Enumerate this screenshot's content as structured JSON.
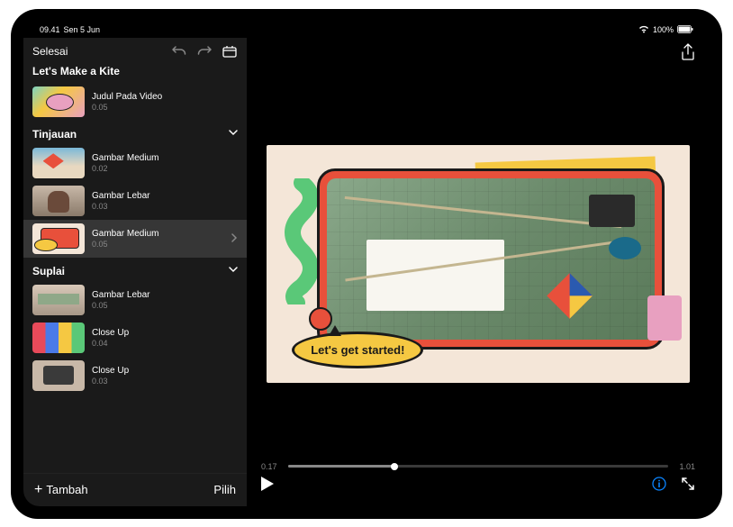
{
  "status_bar": {
    "time": "09.41",
    "date": "Sen 5 Jun",
    "battery": "100%"
  },
  "sidebar": {
    "done_label": "Selesai",
    "project_title": "Let's Make a Kite",
    "title_clip": {
      "name": "Judul Pada Video",
      "duration": "0.05"
    },
    "sections": [
      {
        "title": "Tinjauan",
        "clips": [
          {
            "name": "Gambar Medium",
            "duration": "0.02",
            "thumb": "kite"
          },
          {
            "name": "Gambar Lebar",
            "duration": "0.03",
            "thumb": "person"
          },
          {
            "name": "Gambar Medium",
            "duration": "0.05",
            "thumb": "collage",
            "selected": true
          }
        ]
      },
      {
        "title": "Suplai",
        "clips": [
          {
            "name": "Gambar Lebar",
            "duration": "0.05",
            "thumb": "shelf"
          },
          {
            "name": "Close Up",
            "duration": "0.04",
            "thumb": "colors"
          },
          {
            "name": "Close Up",
            "duration": "0.03",
            "thumb": "tools"
          }
        ]
      }
    ],
    "add_label": "Tambah",
    "select_label": "Pilih"
  },
  "preview": {
    "bubble_text": "Let's get started!",
    "time_current": "0.17",
    "time_total": "1.01"
  }
}
